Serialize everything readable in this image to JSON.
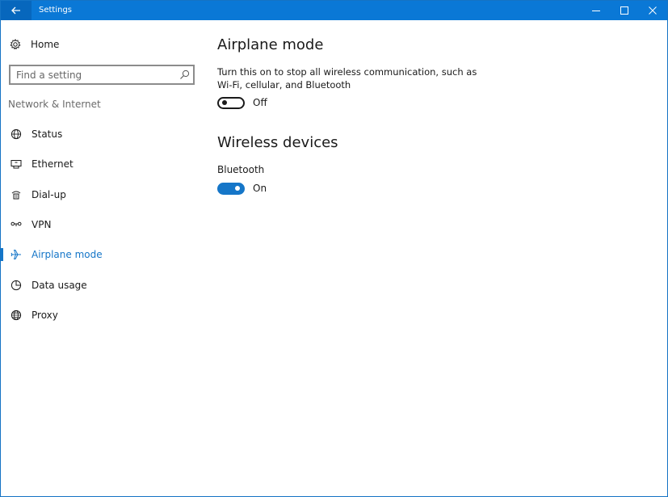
{
  "window": {
    "title": "Settings",
    "back_icon": "back-arrow-icon",
    "controls": [
      "minimize-icon",
      "maximize-icon",
      "close-icon"
    ]
  },
  "sidebar": {
    "home": {
      "label": "Home",
      "icon": "gear-icon"
    },
    "search": {
      "placeholder": "Find a setting",
      "value": ""
    },
    "section": "Network & Internet",
    "items": [
      {
        "label": "Status",
        "icon": "globe-status-icon",
        "active": false
      },
      {
        "label": "Ethernet",
        "icon": "ethernet-icon",
        "active": false
      },
      {
        "label": "Dial-up",
        "icon": "dialup-icon",
        "active": false
      },
      {
        "label": "VPN",
        "icon": "vpn-icon",
        "active": false
      },
      {
        "label": "Airplane mode",
        "icon": "airplane-icon",
        "active": true
      },
      {
        "label": "Data usage",
        "icon": "data-usage-icon",
        "active": false
      },
      {
        "label": "Proxy",
        "icon": "globe-icon",
        "active": false
      }
    ]
  },
  "main": {
    "airplane": {
      "title": "Airplane mode",
      "description": "Turn this on to stop all wireless communication, such as Wi-Fi, cellular, and Bluetooth",
      "toggle_state": "Off"
    },
    "wireless": {
      "title": "Wireless devices",
      "bluetooth_label": "Bluetooth",
      "toggle_state": "On"
    }
  },
  "colors": {
    "titlebar": "#0a78d6",
    "accent": "#1576c8",
    "text": "#1a1a1a",
    "muted": "#6b6b6b"
  }
}
